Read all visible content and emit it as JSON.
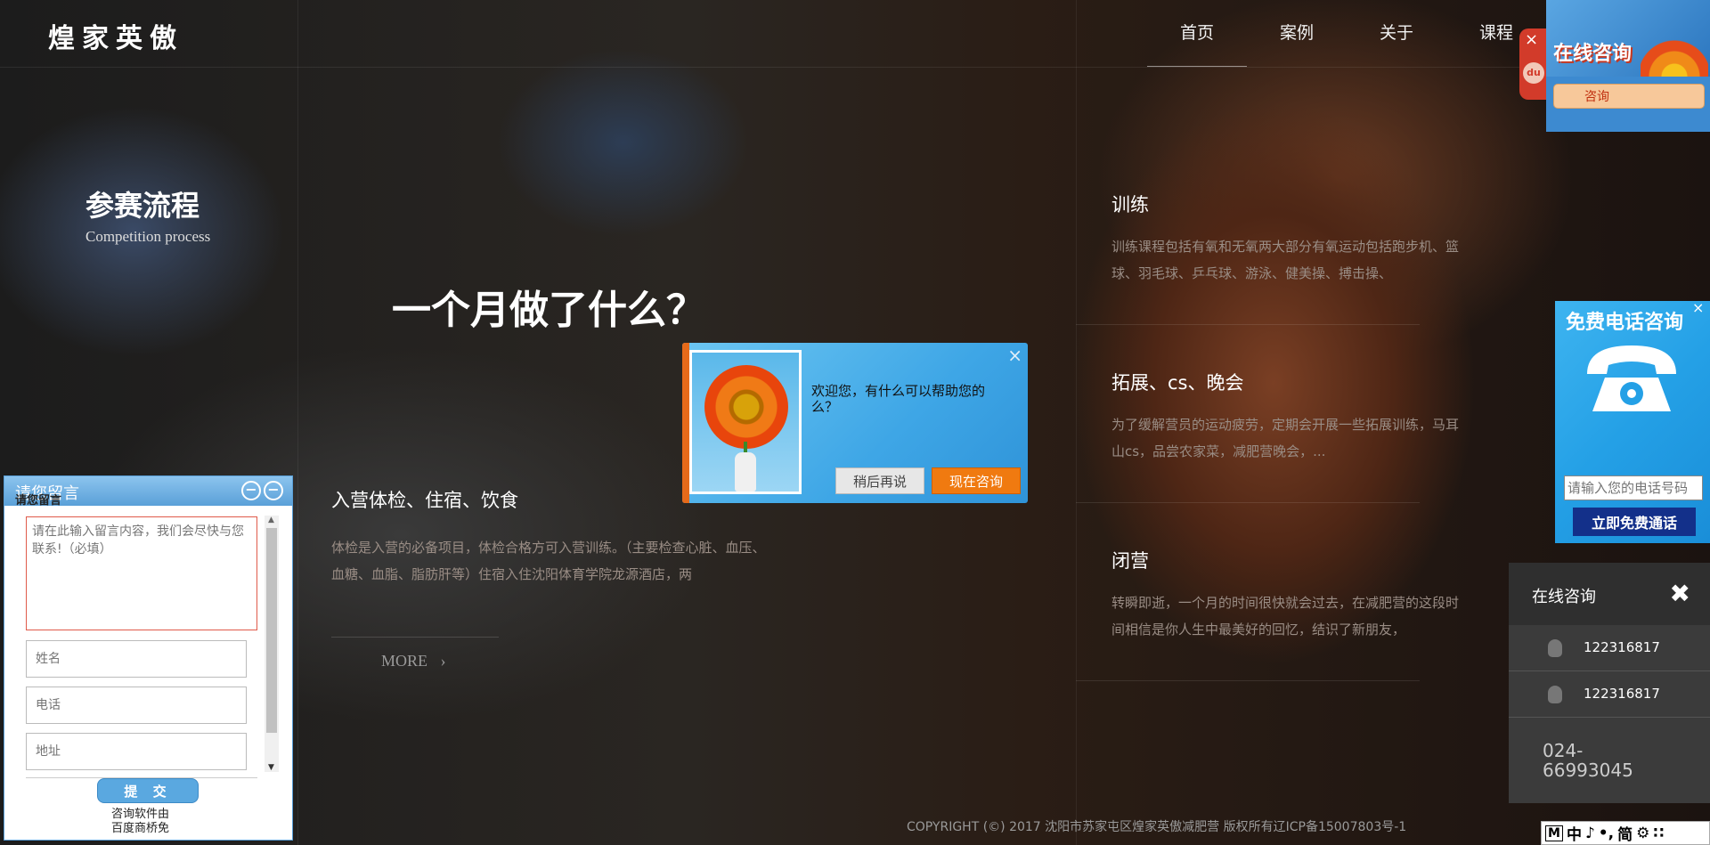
{
  "header": {
    "logo": "煌家英傲",
    "nav": [
      "首页",
      "案例",
      "关于",
      "课程"
    ]
  },
  "section": {
    "title": "参赛流程",
    "subtitle": "Competition process",
    "headline": "一个月做了什么？"
  },
  "items": [
    {
      "title": "入营体检、住宿、饮食",
      "desc": "体检是入营的必备项目，体检合格方可入营训练。（主要检查心脏、血压、血糖、血脂、脂肪肝等）住宿入住沈阳体育学院龙源酒店，两"
    },
    {
      "title": "训练",
      "desc": "训练课程包括有氧和无氧两大部分有氧运动包括跑步机、篮球、羽毛球、乒乓球、游泳、健美操、搏击操、"
    },
    {
      "title": "拓展、cs、晚会",
      "desc": "为了缓解营员的运动疲劳，定期会开展一些拓展训练，马耳山cs，品尝农家菜，减肥营晚会，..."
    },
    {
      "title": "闭营",
      "desc": "转瞬即逝，一个月的时间很快就会过去，在减肥营的这段时间相信是你人生中最美好的回忆，结识了新朋友，"
    }
  ],
  "more_label": "MORE",
  "copyright": "COPYRIGHT (©) 2017 沈阳市苏家屯区煌家英傲减肥营 版权所有辽ICP备15007803号-1",
  "message_box": {
    "title": "请您留言",
    "title_overlay": "请您留言",
    "textarea_placeholder": "请在此输入留言内容，我们会尽快与您联系!（必填）",
    "name_placeholder": "姓名",
    "phone_placeholder": "电话",
    "address_placeholder": "地址",
    "submit_label": "提 交",
    "footer_line1": "咨询软件由",
    "footer_line2": "百度商桥免"
  },
  "welcome_popup": {
    "text": "欢迎您，有什么可以帮助您的么？",
    "later_label": "稍后再说",
    "now_label": "现在咨询"
  },
  "online_consult": {
    "title": "在线咨询",
    "button_label": "咨询"
  },
  "free_call": {
    "title": "免费电话咨询",
    "input_placeholder": "请输入您的电话号码",
    "button_label": "立即免费通话"
  },
  "qq_panel": {
    "title": "在线咨询",
    "numbers": [
      "122316817",
      "122316817"
    ],
    "phone": "024-66993045"
  },
  "ime": [
    "M",
    "中",
    "♪",
    "•,",
    "简",
    "⚙",
    "∷"
  ]
}
